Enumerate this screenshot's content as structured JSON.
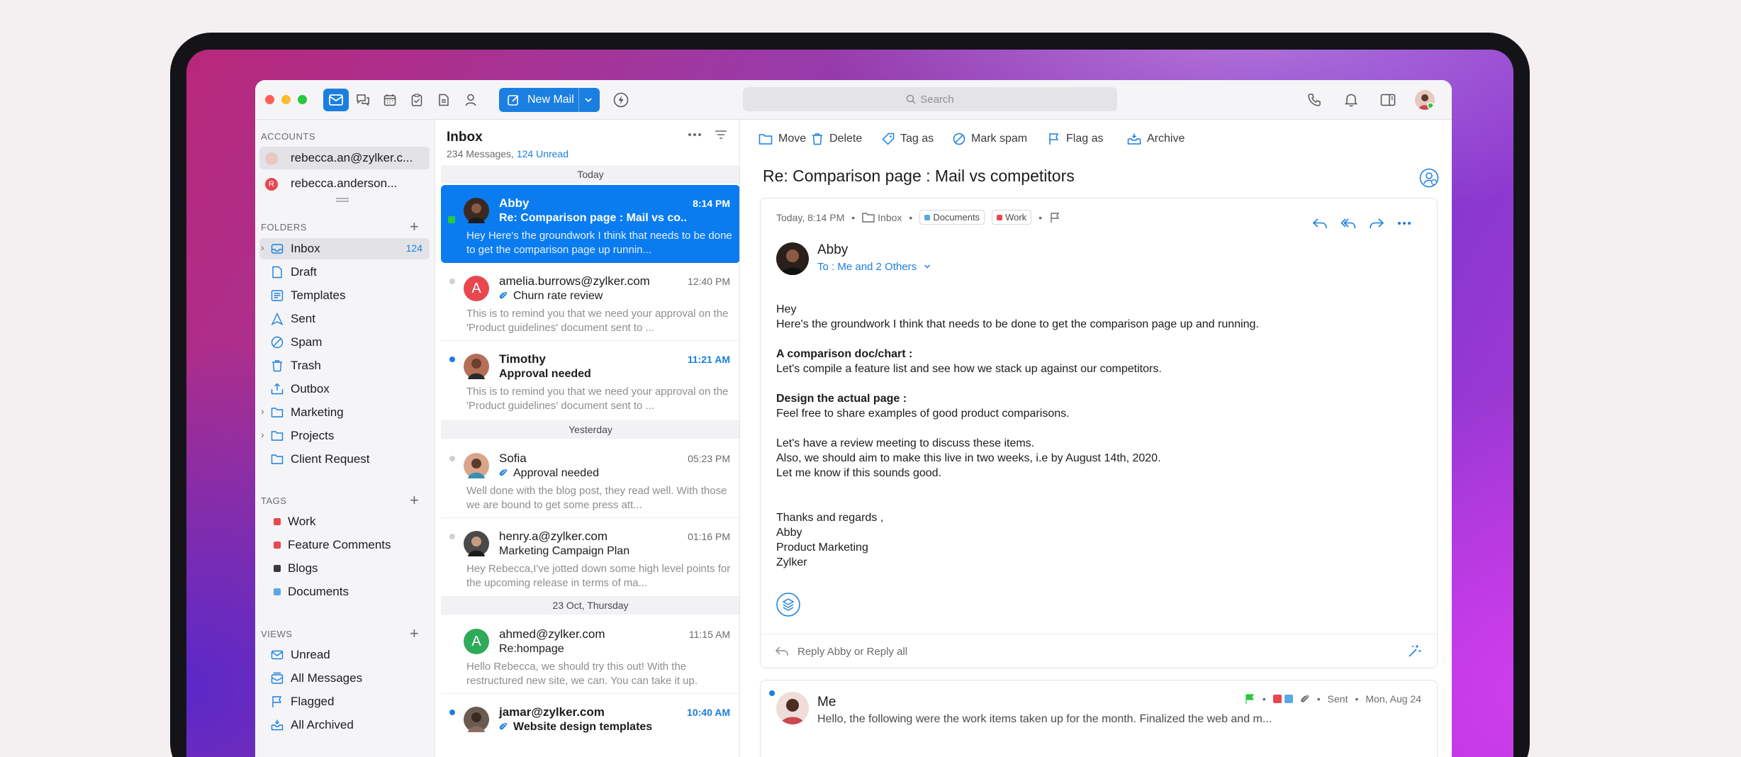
{
  "toolbar": {
    "new_mail": "New Mail",
    "search_placeholder": "Search"
  },
  "sidebar": {
    "accounts_title": "ACCOUNTS",
    "accounts": [
      "rebecca.an@zylker.c...",
      "rebecca.anderson..."
    ],
    "folders_title": "FOLDERS",
    "folders": [
      {
        "label": "Inbox",
        "count": "124"
      },
      {
        "label": "Draft"
      },
      {
        "label": "Templates"
      },
      {
        "label": "Sent"
      },
      {
        "label": "Spam"
      },
      {
        "label": "Trash"
      },
      {
        "label": "Outbox"
      },
      {
        "label": "Marketing"
      },
      {
        "label": "Projects"
      },
      {
        "label": "Client Request"
      }
    ],
    "tags_title": "TAGS",
    "tags": [
      {
        "label": "Work",
        "color": "#e8474f"
      },
      {
        "label": "Feature Comments",
        "color": "#e8474f"
      },
      {
        "label": "Blogs",
        "color": "#3a3a3f"
      },
      {
        "label": "Documents",
        "color": "#5aa9e6"
      }
    ],
    "views_title": "VIEWS",
    "views": [
      "Unread",
      "All Messages",
      "Flagged",
      "All Archived"
    ]
  },
  "list": {
    "title": "Inbox",
    "count_text": "234 Messages,",
    "unread_text": "124 Unread",
    "days": [
      "Today",
      "Yesterday",
      "23 Oct, Thursday"
    ],
    "messages": [
      {
        "from": "Abby",
        "time": "8:14 PM",
        "subject": "Re: Comparison page : Mail vs co..",
        "preview": "Hey  Here's the groundwork I think  that needs to be done to get the comparison page up runnin..."
      },
      {
        "from": "amelia.burrows@zylker.com",
        "time": "12:40 PM",
        "subject": "Churn rate review",
        "preview": "This is to remind you that we need your approval on the 'Product guidelines' document sent to ...",
        "avatar_letter": "A"
      },
      {
        "from": "Timothy",
        "time": "11:21 AM",
        "subject": "Approval needed",
        "preview": "This is to remind you that we need your approval on the 'Product guidelines' document sent to ..."
      },
      {
        "from": "Sofia",
        "time": "05:23 PM",
        "subject": "Approval needed",
        "preview": "Well done with the blog post, they read well. With those we are bound to get some press att..."
      },
      {
        "from": "henry.a@zylker.com",
        "time": "01:16 PM",
        "subject": "Marketing Campaign Plan",
        "preview": "Hey Rebecca,I've jotted down some high level points for the upcoming release  in terms of ma..."
      },
      {
        "from": "ahmed@zylker.com",
        "time": "11:15 AM",
        "subject": "Re:hompage",
        "preview": "Hello Rebecca, we should try this out! With the restructured new site, we can. You can take it up.",
        "avatar_letter": "A"
      },
      {
        "from": "jamar@zylker.com",
        "time": "10:40 AM",
        "subject": "Website design templates"
      }
    ]
  },
  "pane": {
    "actions": [
      "Move",
      "Delete",
      "Tag as",
      "Mark spam",
      "Flag as",
      "Archive"
    ],
    "title": "Re: Comparison page : Mail vs competitors",
    "meta_time": "Today, 8:14 PM",
    "meta_folder": "Inbox",
    "chips": [
      {
        "label": "Documents",
        "color": "#5aa9e6"
      },
      {
        "label": "Work",
        "color": "#e8474f"
      }
    ],
    "sender": "Abby",
    "to": "To : Me and 2 Others",
    "body": {
      "greet": "Hey",
      "line1": "Here's the groundwork I think  that needs to be done to get the comparison page up and running.",
      "h1": "A comparison doc/chart :",
      "p1": "Let's compile a feature list and see how we stack up against our competitors.",
      "h2": "Design the actual page :",
      "p2": "Feel free to share examples of good product comparisons.",
      "p3a": "Let's have a review meeting to discuss these items.",
      "p3b": "Also, we should aim to make this live in two weeks, i.e by August 14th, 2020.",
      "p3c": "Let me know if this sounds good.",
      "s1": "Thanks and regards ,",
      "s2": "Abby",
      "s3": "Product Marketing",
      "s4": "Zylker"
    },
    "reply_text": "Reply Abby or Reply all",
    "thread": {
      "name": "Me",
      "preview": "Hello, the following were the work items taken up for the month. Finalized the web and m...",
      "status": "Sent",
      "date": "Mon, Aug 24"
    }
  },
  "colors": {
    "accent": "#1a7fe0",
    "traffic_red": "#ff5f57",
    "traffic_yellow": "#febc2e",
    "traffic_green": "#28c840"
  }
}
